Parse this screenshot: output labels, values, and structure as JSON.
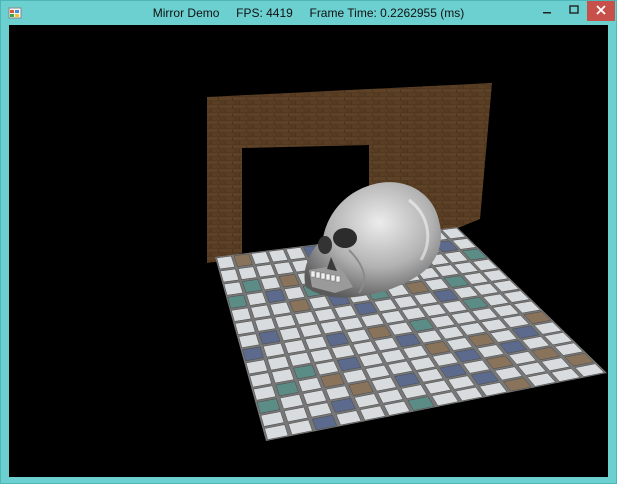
{
  "window": {
    "title": "Mirror Demo",
    "fps_label": "FPS: 4419",
    "frame_time_label": "Frame Time: 0.2262955 (ms)"
  },
  "icons": {
    "app": "directx-app-icon",
    "minimize": "minimize-icon",
    "maximize": "maximize-icon",
    "close": "close-icon"
  },
  "colors": {
    "frame": "#6ccfd0",
    "close_button": "#c7504a",
    "viewport_background": "#000000",
    "brick": "#6b4a2e",
    "tile_blue": "#5b6a8d",
    "tile_teal": "#5c8c86",
    "tile_tan": "#8a735b",
    "tile_white": "#d9dcde",
    "skull": "#b8b8b8"
  }
}
